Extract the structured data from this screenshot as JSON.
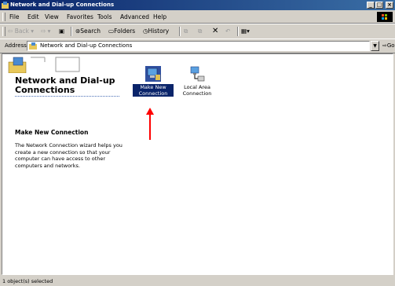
{
  "window": {
    "title": "Network and Dial-up Connections"
  },
  "menu": {
    "items": [
      "File",
      "Edit",
      "View",
      "Favorites",
      "Tools",
      "Advanced",
      "Help"
    ]
  },
  "toolbar": {
    "back": "Back",
    "search": "Search",
    "folders": "Folders",
    "history": "History"
  },
  "address": {
    "label": "Address",
    "value": "Network and Dial-up Connections",
    "go": "Go"
  },
  "left_pane": {
    "title": "Network and Dial-up Connections",
    "subtitle": "Make New Connection",
    "description": "The Network Connection wizard helps you create a new connection so that your computer can have access to other computers and networks."
  },
  "items": [
    {
      "label": "Make New Connection",
      "selected": true
    },
    {
      "label": "Local Area Connection",
      "selected": false
    }
  ],
  "status": {
    "text": "1 object(s) selected"
  },
  "colors": {
    "titlebar": "#0a246a",
    "selection": "#0a246a",
    "arrow": "#ff0000"
  }
}
